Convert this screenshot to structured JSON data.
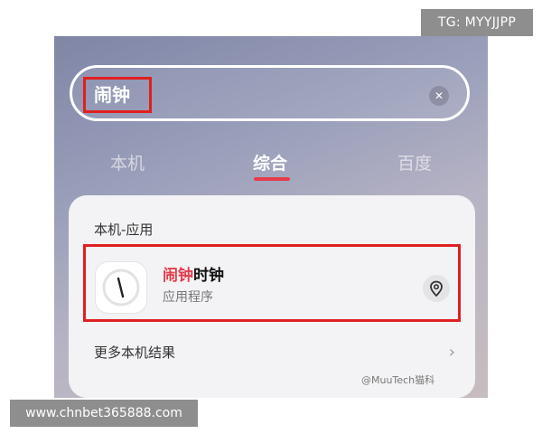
{
  "overlay": {
    "tg_badge": "TG: MYYJJPP",
    "url_badge": "www.chnbet365888.com",
    "watermark": "@MuuTech猫科"
  },
  "search": {
    "query": "闹钟",
    "clear_icon": "close-icon"
  },
  "tabs": [
    {
      "label": "本机",
      "active": false
    },
    {
      "label": "综合",
      "active": true
    },
    {
      "label": "百度",
      "active": false
    }
  ],
  "results": {
    "section_title": "本机-应用",
    "app": {
      "name_highlight": "闹钟",
      "name_rest": "时钟",
      "subtitle": "应用程序",
      "icon": "clock-icon",
      "action_icon": "location-pin-icon"
    },
    "more_label": "更多本机结果",
    "more_icon": "chevron-right-icon"
  },
  "colors": {
    "accent": "#e53d4b",
    "annotation_box": "#e02020"
  }
}
